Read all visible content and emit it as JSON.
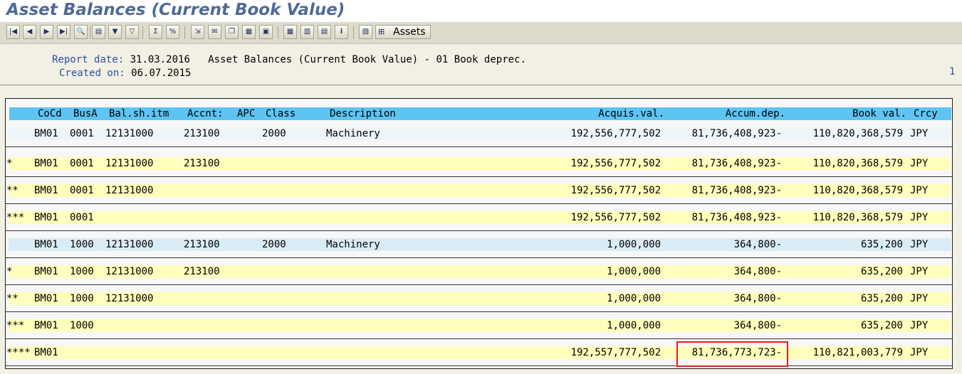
{
  "title": "Asset Balances (Current Book Value)",
  "toolbar": {
    "icons": [
      "first-page-icon",
      "prev-page-icon",
      "next-page-icon",
      "last-page-icon",
      "details-icon",
      "print-icon",
      "filter-icon",
      "set-filter-icon",
      "sum-icon",
      "subtotal-icon",
      "export-icon",
      "send-icon",
      "copy-icon",
      "choose-layout-icon",
      "save-layout-icon",
      "grid-view-icon",
      "columns-icon",
      "rows-icon",
      "info-icon",
      "layout-icon",
      "hierarchy-icon"
    ],
    "assets_label": "Assets"
  },
  "header": {
    "report_date_label": "Report date:",
    "report_date": "31.03.2016",
    "report_title": "Asset Balances (Current Book Value) - 01 Book deprec.",
    "created_on_label": "Created on:",
    "created_on": "06.07.2015",
    "page": "1"
  },
  "columns": {
    "cocd": "CoCd",
    "busa": "BusA",
    "balsh": "Bal.sh.itm",
    "accnt": "Accnt:",
    "apc": "APC",
    "class": "Class",
    "desc": "Description",
    "acq": "Acquis.val.",
    "dep": "Accum.dep.",
    "book": "Book val.",
    "crcy": "Crcy"
  },
  "rows": [
    {
      "lvl": "",
      "cocd": "BM01",
      "busa": "0001",
      "balsh": "12131000",
      "apc": "213100",
      "cls": "2000",
      "desc": "Machinery",
      "acq": "192,556,777,502",
      "dep": "81,736,408,923-",
      "book": "110,820,368,579",
      "crcy": "JPY"
    },
    {
      "lvl": "*",
      "cocd": "BM01",
      "busa": "0001",
      "balsh": "12131000",
      "apc": "213100",
      "cls": "",
      "desc": "",
      "acq": "192,556,777,502",
      "dep": "81,736,408,923-",
      "book": "110,820,368,579",
      "crcy": "JPY"
    },
    {
      "lvl": "**",
      "cocd": "BM01",
      "busa": "0001",
      "balsh": "12131000",
      "apc": "",
      "cls": "",
      "desc": "",
      "acq": "192,556,777,502",
      "dep": "81,736,408,923-",
      "book": "110,820,368,579",
      "crcy": "JPY"
    },
    {
      "lvl": "***",
      "cocd": "BM01",
      "busa": "0001",
      "balsh": "",
      "apc": "",
      "cls": "",
      "desc": "",
      "acq": "192,556,777,502",
      "dep": "81,736,408,923-",
      "book": "110,820,368,579",
      "crcy": "JPY"
    },
    {
      "lvl": "",
      "cocd": "BM01",
      "busa": "1000",
      "balsh": "12131000",
      "apc": "213100",
      "cls": "2000",
      "desc": "Machinery",
      "acq": "1,000,000",
      "dep": "364,800-",
      "book": "635,200",
      "crcy": "JPY"
    },
    {
      "lvl": "*",
      "cocd": "BM01",
      "busa": "1000",
      "balsh": "12131000",
      "apc": "213100",
      "cls": "",
      "desc": "",
      "acq": "1,000,000",
      "dep": "364,800-",
      "book": "635,200",
      "crcy": "JPY"
    },
    {
      "lvl": "**",
      "cocd": "BM01",
      "busa": "1000",
      "balsh": "12131000",
      "apc": "",
      "cls": "",
      "desc": "",
      "acq": "1,000,000",
      "dep": "364,800-",
      "book": "635,200",
      "crcy": "JPY"
    },
    {
      "lvl": "***",
      "cocd": "BM01",
      "busa": "1000",
      "balsh": "",
      "apc": "",
      "cls": "",
      "desc": "",
      "acq": "1,000,000",
      "dep": "364,800-",
      "book": "635,200",
      "crcy": "JPY"
    },
    {
      "lvl": "****",
      "cocd": "BM01",
      "busa": "",
      "balsh": "",
      "apc": "",
      "cls": "",
      "desc": "",
      "acq": "192,557,777,502",
      "dep": "81,736,773,723-",
      "book": "110,821,003,779",
      "crcy": "JPY"
    }
  ],
  "colors": {
    "header_bg": "#5ec4f1",
    "total_row": "#fffebc",
    "item_row": "#d9ecf5",
    "highlight": "#e02020",
    "title": "#4f6a96"
  }
}
